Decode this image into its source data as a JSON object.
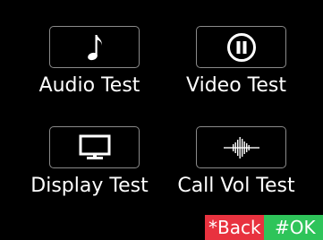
{
  "menu": {
    "items": [
      {
        "label": "Audio Test",
        "icon": "music-note-icon"
      },
      {
        "label": "Video Test",
        "icon": "pause-circle-icon"
      },
      {
        "label": "Display Test",
        "icon": "monitor-icon"
      },
      {
        "label": "Call Vol Test",
        "icon": "waveform-icon"
      }
    ]
  },
  "softkeys": {
    "back": {
      "label": "*Back",
      "color": "#e8323f"
    },
    "ok": {
      "label": "#OK",
      "color": "#2ec45a"
    }
  }
}
